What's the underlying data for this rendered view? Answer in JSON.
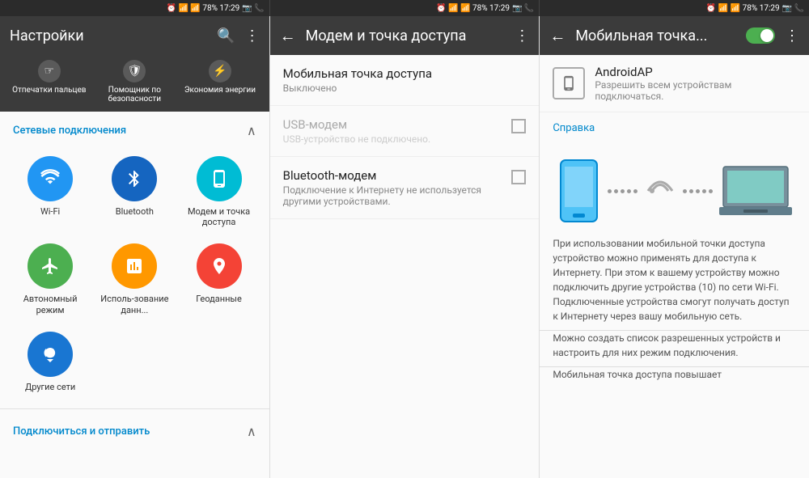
{
  "statusBar": {
    "panels": [
      {
        "icons": "📶 📶",
        "battery": "78%",
        "time": "17:29",
        "extra": "📷 📞"
      },
      {
        "icons": "📶 📶",
        "battery": "78%",
        "time": "17:29",
        "extra": "📷 📞"
      },
      {
        "icons": "📶 📶",
        "battery": "78%",
        "time": "17:29",
        "extra": "📷 📞"
      }
    ]
  },
  "screen1": {
    "title": "Настройки",
    "quickActions": [
      {
        "label": "Отпечатки пальцев",
        "icon": "☞"
      },
      {
        "label": "Помощник по безопасности",
        "icon": "🛡"
      },
      {
        "label": "Экономия энергии",
        "icon": "⚡"
      }
    ],
    "sectionTitle": "Сетевые подключения",
    "icons": [
      {
        "label": "Wi-Fi",
        "icon": "📶",
        "color": "circle-blue"
      },
      {
        "label": "Bluetooth",
        "icon": "✳",
        "color": "circle-blue2"
      },
      {
        "label": "Модем и точка доступа",
        "icon": "📱",
        "color": "circle-teal"
      },
      {
        "label": "Автономный режим",
        "icon": "✈",
        "color": "circle-green"
      },
      {
        "label": "Исполь-зование данн...",
        "icon": "📊",
        "color": "circle-orange"
      },
      {
        "label": "Геоданные",
        "icon": "📍",
        "color": "circle-red"
      },
      {
        "label": "Другие сети",
        "icon": "📡",
        "color": "circle-blue3"
      }
    ],
    "section2Title": "Подключиться и отправить"
  },
  "screen2": {
    "title": "Модем и точка доступа",
    "mobileHotspot": {
      "title": "Мобильная точка доступа",
      "status": "Выключено"
    },
    "usbModem": {
      "title": "USB-модем",
      "subtitle": "USB-устройство не подключено."
    },
    "bluetoothModem": {
      "title": "Bluetooth-модем",
      "subtitle": "Подключение к Интернету не используется другими устройствами."
    }
  },
  "screen3": {
    "title": "Мобильная точка...",
    "toggleOn": true,
    "apName": "AndroidAP",
    "apDesc": "Разрешить всем устройствам подключаться.",
    "helpTitle": "Справка",
    "helpText1": "При использовании мобильной точки доступа устройство можно применять для доступа к Интернету. При этом к вашему устройству можно подключить другие устройства (10) по сети Wi-Fi. Подключенные устройства смогут получать доступ к Интернету через вашу мобильную сеть.",
    "helpText2": "Можно создать список разрешенных устройств и настроить для них режим подключения.",
    "helpText3": "Мобильная точка доступа повышает"
  }
}
